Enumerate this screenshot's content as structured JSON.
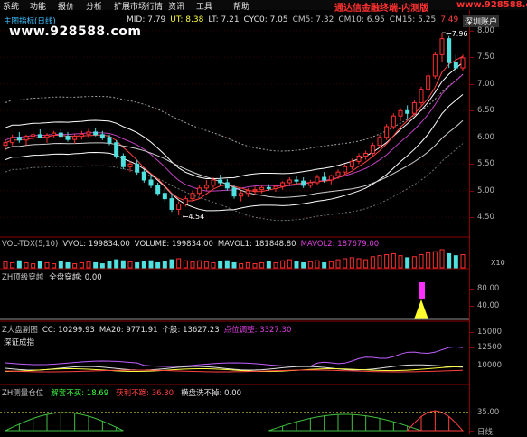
{
  "menu": [
    {
      "label": "系统",
      "x": 3
    },
    {
      "label": "功能",
      "x": 33
    },
    {
      "label": "报价",
      "x": 64
    },
    {
      "label": "分析",
      "x": 95
    },
    {
      "label": "扩展市场行情",
      "x": 126
    },
    {
      "label": "资讯",
      "x": 186
    },
    {
      "label": "工具",
      "x": 217
    },
    {
      "label": "帮助",
      "x": 258
    }
  ],
  "window_title": "通达信金融终端-内测版",
  "brand_site": "www.928588.com",
  "watermark": "www.928588.com",
  "tab_label": "深圳账户",
  "price_header": {
    "title": "主图指标(日线)",
    "items": [
      {
        "text": "MID: 7.79",
        "color": "#e0e0e0"
      },
      {
        "text": "UT: 8.38",
        "color": "#ffff40"
      },
      {
        "text": "LT: 7.21",
        "color": "#e0e0e0"
      },
      {
        "text": "CYC0: 7.05",
        "color": "#e0e0e0"
      },
      {
        "text": "CM5: 7.32",
        "color": "#c0c0c0"
      },
      {
        "text": "CM10: 6.95",
        "color": "#c0c0c0"
      },
      {
        "text": "CM15: 5.25",
        "color": "#c0c0c0"
      },
      {
        "text": "7.49",
        "color": "#ff4040"
      }
    ]
  },
  "price_axis": {
    "labels": [
      "8.00",
      "7.50",
      "7.00",
      "6.50",
      "6.00",
      "5.50",
      "5.00",
      "4.50"
    ],
    "high_label": "7.96",
    "low_label": "4.54"
  },
  "volume_panel": {
    "title_items": [
      {
        "text": "VOL-TDX(5,10)",
        "color": "#c0c0c0"
      },
      {
        "text": "VVOL: 199834.00",
        "color": "#e0e0e0"
      },
      {
        "text": "VOLUME: 199834.00",
        "color": "#e0e0e0"
      },
      {
        "text": "MAVOL1: 181848.80",
        "color": "#e0e0e0"
      },
      {
        "text": "MAVOL2: 187679.00",
        "color": "#e040e0"
      }
    ],
    "unit": "X10"
  },
  "zh_panel": {
    "title_items": [
      {
        "text": "ZH顶级穿越",
        "color": "#c0c0c0"
      },
      {
        "text": "全盘穿越: 0.00",
        "color": "#e0e0e0"
      }
    ],
    "axis_labels": [
      "80.00",
      "40.00"
    ]
  },
  "market_panel": {
    "title_items": [
      {
        "text": "Z大盘副图",
        "color": "#c0c0c0"
      },
      {
        "text": "CC: 10299.93",
        "color": "#e0e0e0"
      },
      {
        "text": "MA20: 9771.91",
        "color": "#e0e0e0"
      },
      {
        "text": "个股: 13627.23",
        "color": "#e0e0e0"
      },
      {
        "text": "点位调整: 3327.30",
        "color": "#e040e0"
      }
    ],
    "subtitle": "深证成指",
    "axis_labels": [
      "15000",
      "12500",
      "10000"
    ]
  },
  "position_panel": {
    "title_items": [
      {
        "text": "ZH测量仓位",
        "color": "#c0c0c0"
      },
      {
        "text": "解套不买: 18.69",
        "color": "#40ff40"
      },
      {
        "text": "获利不跑: 36.30",
        "color": "#ff4040"
      },
      {
        "text": "横盘洗不掉: 0.00",
        "color": "#e0e0e0"
      }
    ],
    "axis_labels": [
      "35.00",
      "日线"
    ]
  },
  "chart_data": {
    "type": "candlestick",
    "candles": [
      [
        5.85,
        5.95,
        5.75,
        5.9
      ],
      [
        5.9,
        6.05,
        5.85,
        6.0
      ],
      [
        6.0,
        6.1,
        5.9,
        5.95
      ],
      [
        5.95,
        6.05,
        5.85,
        6.02
      ],
      [
        6.02,
        6.1,
        5.95,
        6.05
      ],
      [
        6.05,
        6.15,
        5.98,
        6.0
      ],
      [
        6.0,
        6.08,
        5.9,
        6.04
      ],
      [
        6.04,
        6.12,
        5.98,
        6.08
      ],
      [
        6.08,
        6.15,
        6.0,
        6.02
      ],
      [
        6.02,
        6.1,
        5.92,
        5.96
      ],
      [
        5.96,
        6.06,
        5.88,
        6.02
      ],
      [
        6.02,
        6.12,
        5.96,
        6.06
      ],
      [
        6.06,
        6.16,
        6.0,
        6.1
      ],
      [
        6.1,
        6.18,
        6.02,
        6.05
      ],
      [
        6.05,
        6.12,
        5.95,
        6.0
      ],
      [
        6.0,
        6.05,
        5.85,
        5.9
      ],
      [
        5.9,
        5.95,
        5.6,
        5.65
      ],
      [
        5.65,
        5.7,
        5.4,
        5.45
      ],
      [
        5.45,
        5.55,
        5.35,
        5.5
      ],
      [
        5.5,
        5.58,
        5.3,
        5.35
      ],
      [
        5.35,
        5.4,
        5.15,
        5.2
      ],
      [
        5.2,
        5.3,
        5.05,
        5.1
      ],
      [
        5.1,
        5.15,
        4.9,
        4.95
      ],
      [
        4.95,
        5.05,
        4.8,
        4.85
      ],
      [
        4.85,
        4.95,
        4.6,
        4.65
      ],
      [
        4.65,
        4.8,
        4.54,
        4.75
      ],
      [
        4.75,
        4.9,
        4.7,
        4.85
      ],
      [
        4.85,
        5.0,
        4.8,
        4.95
      ],
      [
        4.95,
        5.1,
        4.9,
        5.05
      ],
      [
        5.05,
        5.2,
        5.0,
        5.1
      ],
      [
        5.1,
        5.25,
        5.05,
        5.2
      ],
      [
        5.2,
        5.3,
        5.1,
        5.15
      ],
      [
        5.15,
        5.22,
        5.0,
        5.05
      ],
      [
        5.05,
        5.1,
        4.85,
        4.9
      ],
      [
        4.9,
        5.0,
        4.8,
        4.95
      ],
      [
        4.95,
        5.05,
        4.88,
        5.0
      ],
      [
        5.0,
        5.08,
        4.92,
        5.02
      ],
      [
        5.02,
        5.1,
        4.95,
        5.06
      ],
      [
        5.06,
        5.12,
        5.0,
        5.04
      ],
      [
        5.04,
        5.1,
        4.98,
        5.08
      ],
      [
        5.08,
        5.18,
        5.02,
        5.15
      ],
      [
        5.15,
        5.25,
        5.1,
        5.2
      ],
      [
        5.2,
        5.28,
        5.12,
        5.18
      ],
      [
        5.18,
        5.25,
        5.05,
        5.1
      ],
      [
        5.1,
        5.2,
        5.05,
        5.15
      ],
      [
        5.15,
        5.3,
        5.1,
        5.25
      ],
      [
        5.25,
        5.35,
        5.15,
        5.2
      ],
      [
        5.2,
        5.3,
        5.12,
        5.28
      ],
      [
        5.28,
        5.4,
        5.22,
        5.35
      ],
      [
        5.35,
        5.5,
        5.3,
        5.45
      ],
      [
        5.45,
        5.6,
        5.4,
        5.55
      ],
      [
        5.55,
        5.7,
        5.5,
        5.65
      ],
      [
        5.65,
        5.75,
        5.58,
        5.7
      ],
      [
        5.7,
        5.9,
        5.65,
        5.85
      ],
      [
        5.85,
        6.05,
        5.8,
        6.0
      ],
      [
        6.0,
        6.25,
        5.95,
        6.2
      ],
      [
        6.2,
        6.45,
        6.15,
        6.4
      ],
      [
        6.4,
        6.55,
        6.3,
        6.5
      ],
      [
        6.5,
        6.6,
        6.35,
        6.45
      ],
      [
        6.45,
        6.7,
        6.4,
        6.65
      ],
      [
        6.65,
        6.95,
        6.6,
        6.9
      ],
      [
        6.9,
        7.2,
        6.85,
        7.15
      ],
      [
        7.15,
        7.6,
        7.1,
        7.55
      ],
      [
        7.55,
        7.96,
        7.4,
        7.85
      ],
      [
        7.85,
        7.9,
        7.3,
        7.4
      ],
      [
        7.4,
        7.55,
        7.2,
        7.3
      ],
      [
        7.3,
        7.55,
        7.25,
        7.49
      ]
    ],
    "volumes": [
      6,
      5,
      7,
      5,
      4,
      6,
      5,
      4,
      6,
      5,
      4,
      5,
      6,
      5,
      4,
      6,
      8,
      7,
      6,
      5,
      6,
      7,
      5,
      6,
      8,
      9,
      7,
      6,
      7,
      6,
      5,
      6,
      7,
      5,
      4,
      5,
      4,
      5,
      6,
      5,
      7,
      8,
      6,
      5,
      6,
      7,
      5,
      6,
      8,
      9,
      10,
      9,
      8,
      11,
      12,
      13,
      14,
      12,
      10,
      11,
      13,
      15,
      16,
      18,
      14,
      12,
      13
    ],
    "ylim": [
      4.2,
      8.2
    ]
  }
}
